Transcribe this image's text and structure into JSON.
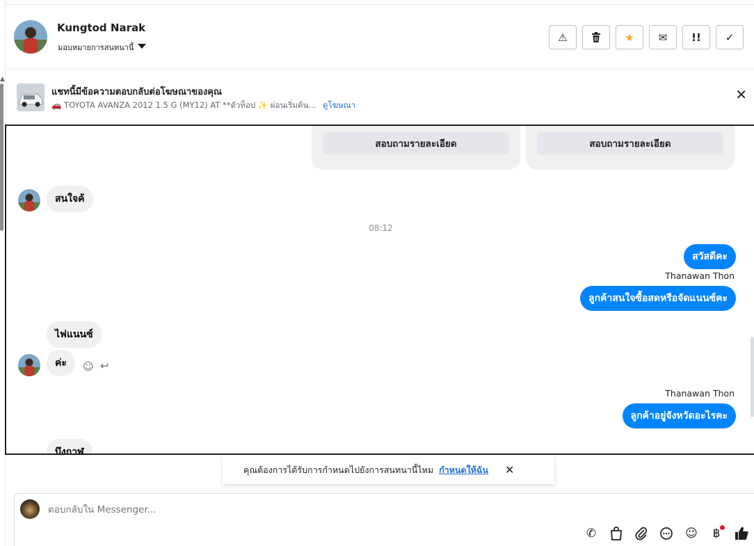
{
  "header": {
    "contact_name": "Kungtod Narak",
    "assign_label": "มอบหมายการสนทนานี้",
    "actions": [
      {
        "name": "spam-button",
        "icon": "warning-icon",
        "glyph": "⚠"
      },
      {
        "name": "delete-button",
        "icon": "trash-icon",
        "glyph": "🗑"
      },
      {
        "name": "star-button",
        "icon": "star-icon",
        "glyph": "★"
      },
      {
        "name": "mark-unread-button",
        "icon": "envelope-icon",
        "glyph": "✉"
      },
      {
        "name": "follow-up-button",
        "icon": "exclamation-icon",
        "glyph": "!!"
      },
      {
        "name": "mark-done-button",
        "icon": "check-icon",
        "glyph": "✓"
      }
    ]
  },
  "ad_banner": {
    "title": "แชทนี้มีข้อความตอบกลับต่อโฆษณาของคุณ",
    "description": "🚗 TOYOTA AVANZA 2012 1.5 G (MY12) AT **ตัวท็อป ✨ ผ่อนเริ่มต้น...",
    "link": "ดูโฆษณา",
    "close_glyph": "✕"
  },
  "conversation": {
    "card_buttons": [
      "สอบถามรายละเอียด",
      "สอบถามรายละเอียด"
    ],
    "messages": {
      "in_1": "สนใจค้",
      "time_1": "08:12",
      "out_1": "สวัสดีคะ",
      "sender_1": "Thanawan Thon",
      "out_2": "ลูกค้าสนใจซื้อสดหรือจัดแนนซ์คะ",
      "in_2": "ไฟแนนซ์",
      "in_3": "ค่ะ",
      "sender_2": "Thanawan Thon",
      "out_3": "ลูกค้าอยู่จังหวัดอะไรคะ",
      "in_4": "บึงกาฬ"
    },
    "reaction_icons": {
      "emoji": "☺",
      "reply": "↩"
    }
  },
  "reminder_prompt": {
    "text": "คุณต้องการได้รับการกำหนดไปยังการสนทนานี้ไหม",
    "link": "กำหนดให้ฉัน",
    "close_glyph": "✕"
  },
  "composer": {
    "placeholder": "ตอบกลับใน Messenger...",
    "tools": [
      {
        "name": "call-icon",
        "glyph": "✆"
      },
      {
        "name": "shopping-bag-icon",
        "glyph": "👜"
      },
      {
        "name": "attachment-icon",
        "glyph": "📎"
      },
      {
        "name": "chat-bubble-icon",
        "glyph": "💬"
      },
      {
        "name": "emoji-icon",
        "glyph": "☺"
      },
      {
        "name": "baht-icon",
        "glyph": "฿"
      },
      {
        "name": "thumbs-up-icon",
        "glyph": "👍"
      }
    ]
  },
  "colors": {
    "outgoing_bubble": "#0084ff",
    "incoming_bubble": "#f0f0f0",
    "link": "#216fdb",
    "star": "#f5a623",
    "notification_dot": "#e41e3f"
  }
}
